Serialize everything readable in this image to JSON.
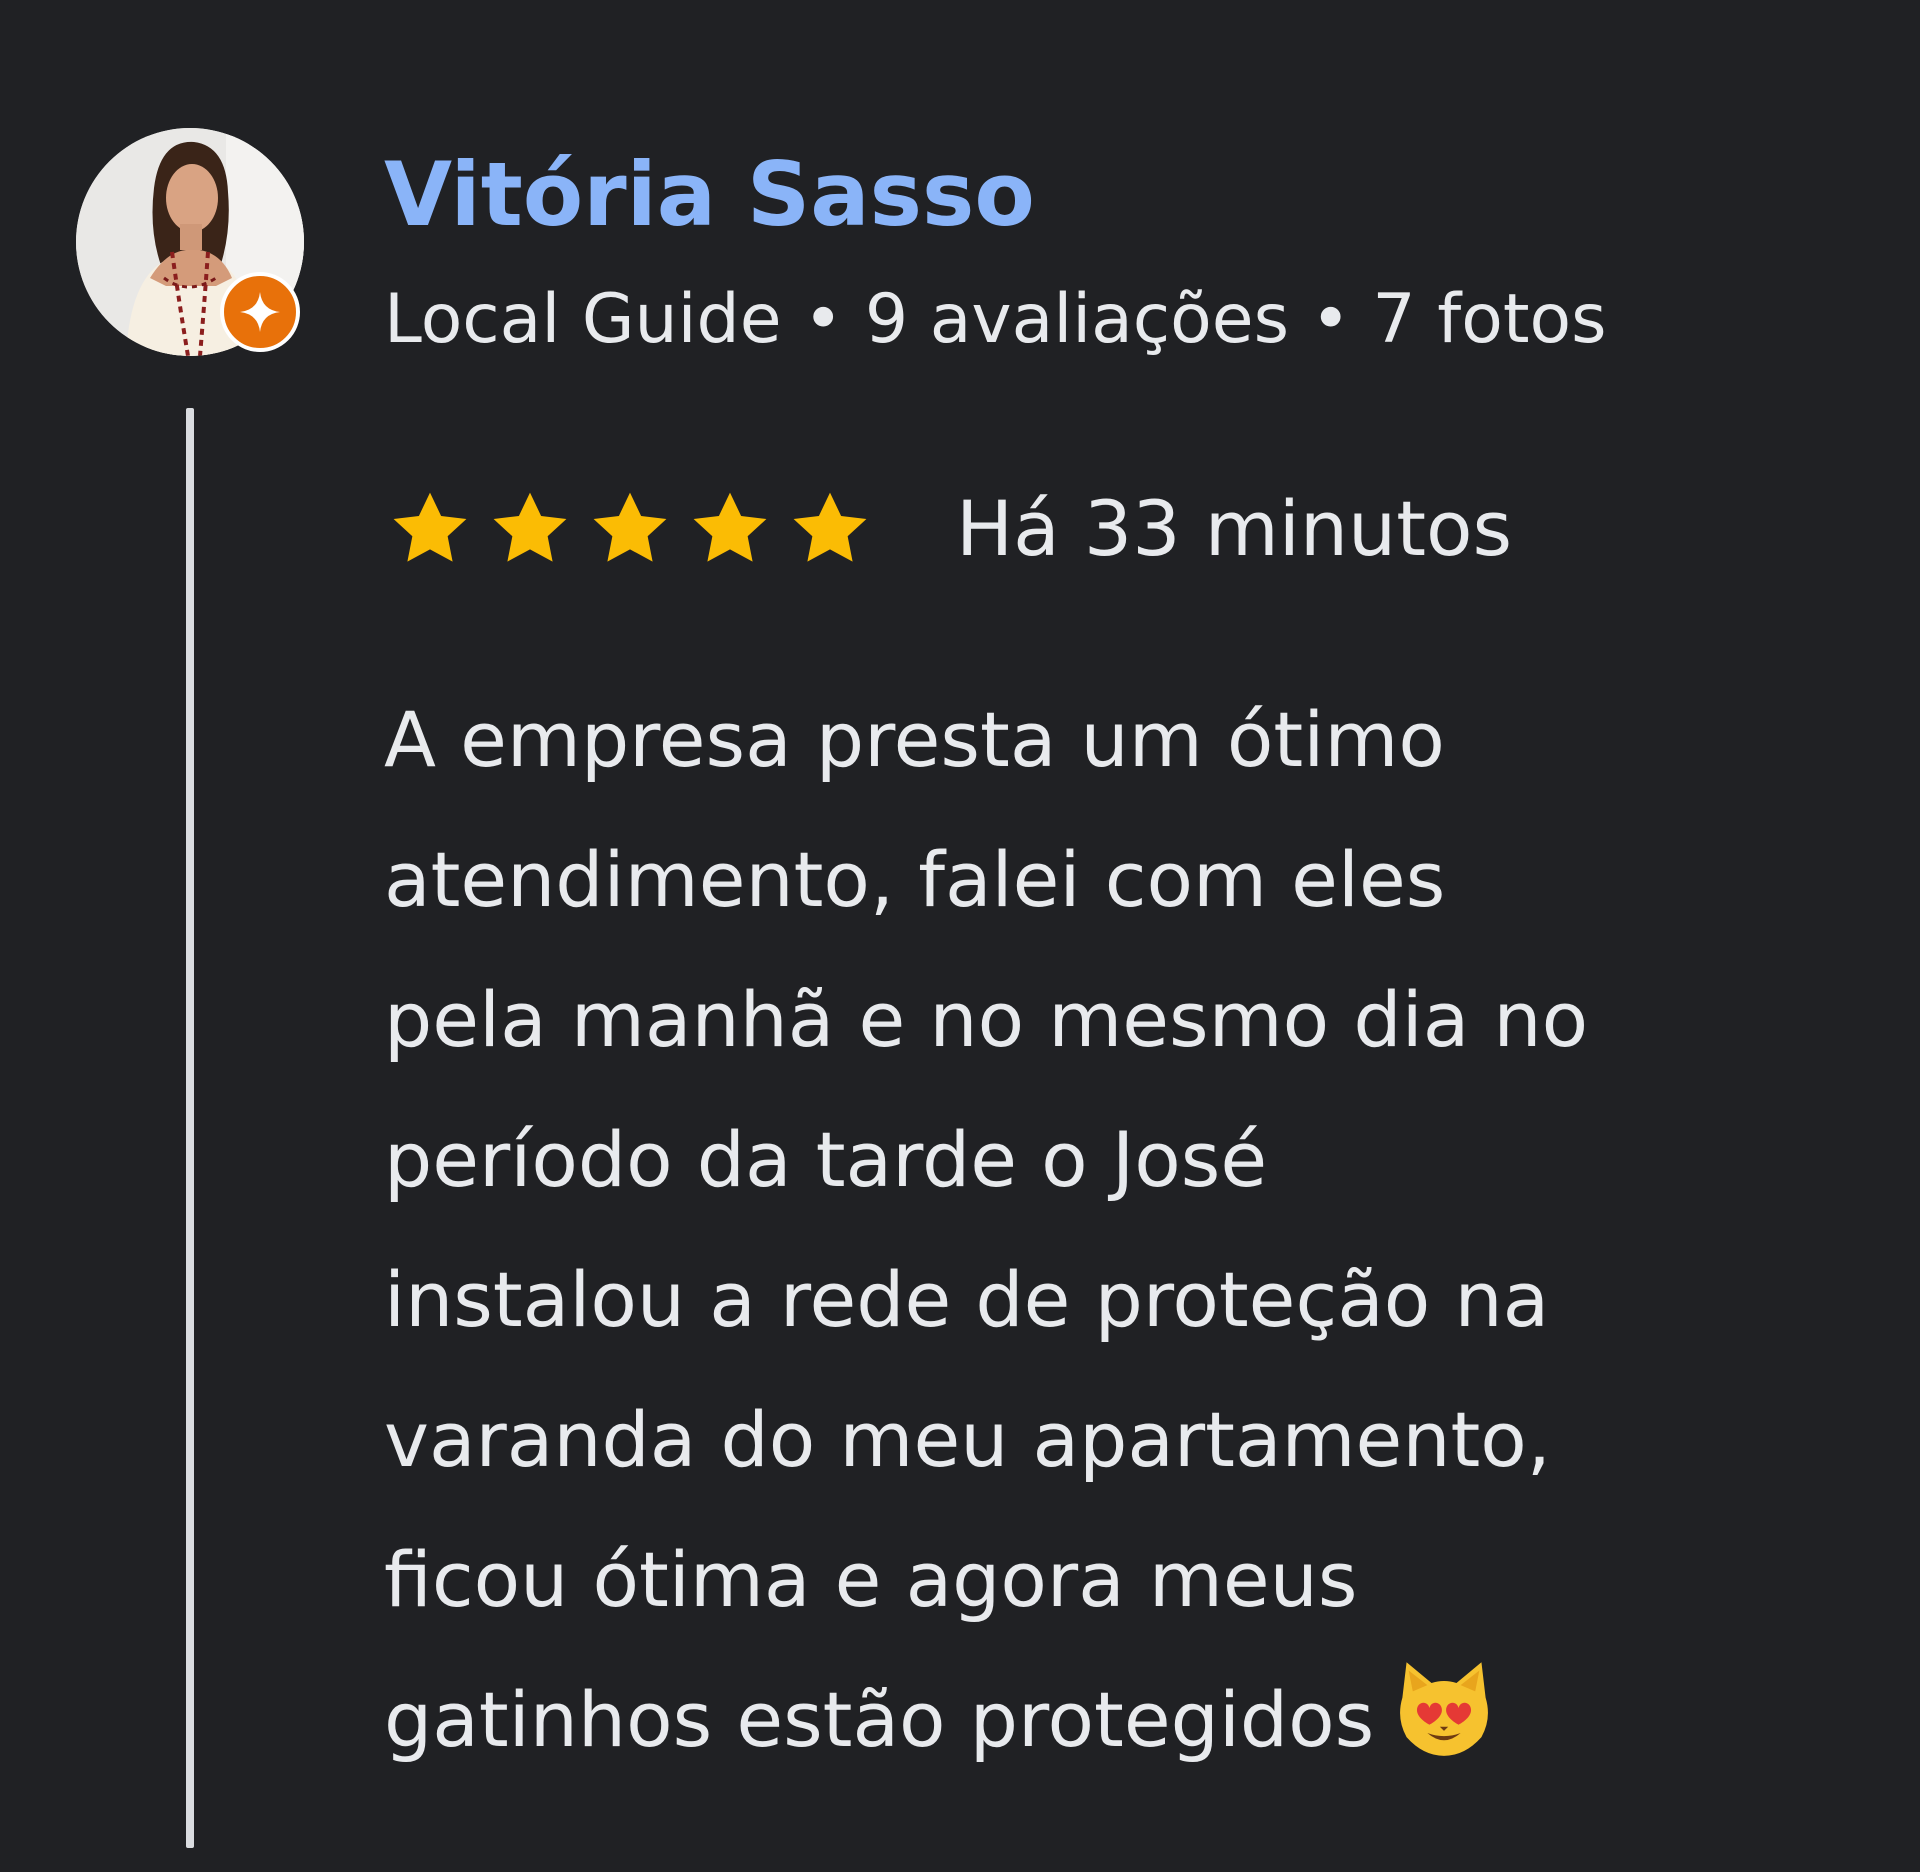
{
  "author": {
    "name": "Vitória Sasso",
    "badge_icon": "local-guide-star-icon",
    "meta": "Local Guide • 9 avaliações • 7 fotos",
    "avatar_icon": "profile-photo"
  },
  "review": {
    "rating": 5,
    "rating_max": 5,
    "star_color": "#fbbc04",
    "time_ago": "Há 33 minutos",
    "text_lines": [
      "A empresa presta um ótimo",
      "atendimento, falei com eles",
      "pela manhã e no mesmo dia no",
      "período da tarde o José",
      "instalou a rede de proteção na",
      "varanda do meu apartamento,",
      "ficou ótima e agora meus",
      "gatinhos estão protegidos"
    ],
    "emoji_icon": "smiling-cat-heart-eyes-icon"
  },
  "colors": {
    "background": "#202124",
    "name": "#8ab4f8",
    "text": "#e8eaed",
    "badge": "#e8710a"
  }
}
